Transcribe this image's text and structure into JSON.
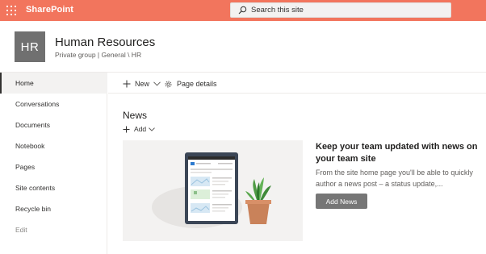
{
  "suite_bar": {
    "brand": "SharePoint",
    "search_placeholder": "Search this site",
    "background_color": "#f2755d"
  },
  "site": {
    "logo_text": "HR",
    "title": "Human Resources",
    "meta": "Private group | General \\ HR"
  },
  "left_nav": {
    "items": [
      {
        "label": "Home",
        "selected": true
      },
      {
        "label": "Conversations"
      },
      {
        "label": "Documents"
      },
      {
        "label": "Notebook"
      },
      {
        "label": "Pages"
      },
      {
        "label": "Site contents"
      },
      {
        "label": "Recycle bin"
      },
      {
        "label": "Edit"
      }
    ]
  },
  "command_bar": {
    "new_label": "New",
    "page_details_label": "Page details"
  },
  "news": {
    "title": "News",
    "add_label": "Add",
    "promo_title": "Keep your team updated with news on your team site",
    "promo_description": "From the site home page you'll be able to quickly author a news post – a status update,...",
    "add_news_button": "Add News"
  }
}
